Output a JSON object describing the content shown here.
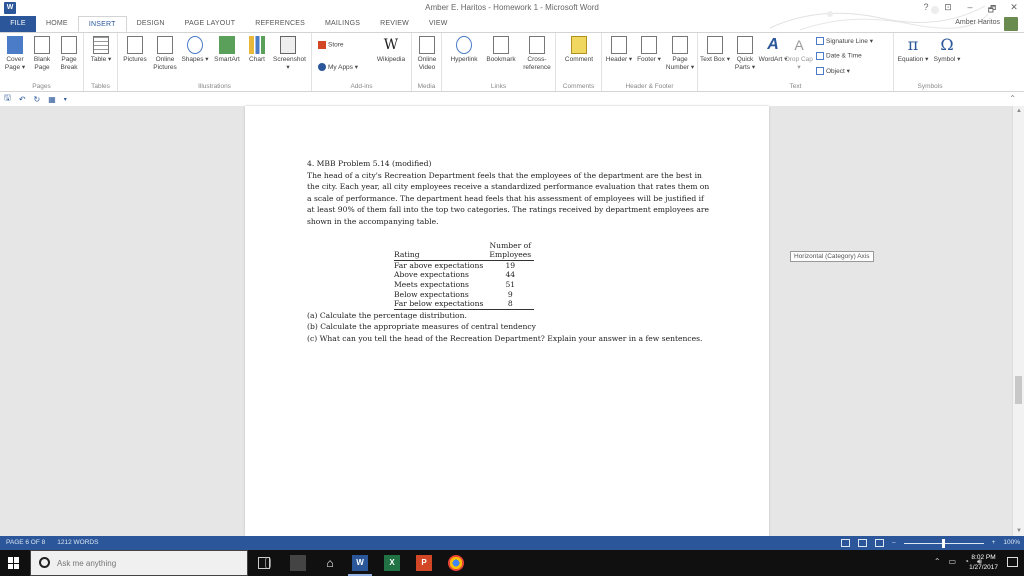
{
  "window": {
    "title": "Amber E. Haritos - Homework 1 - Microsoft Word",
    "controls": [
      "?",
      "⊡",
      "–",
      "🗗",
      "✕"
    ]
  },
  "tabs": [
    {
      "label": "FILE"
    },
    {
      "label": "HOME"
    },
    {
      "label": "INSERT"
    },
    {
      "label": "DESIGN"
    },
    {
      "label": "PAGE LAYOUT"
    },
    {
      "label": "REFERENCES"
    },
    {
      "label": "MAILINGS"
    },
    {
      "label": "REVIEW"
    },
    {
      "label": "VIEW"
    }
  ],
  "active_tab": "INSERT",
  "user_name": "Amber Haritos",
  "ribbon": {
    "groups": [
      {
        "label": "Pages"
      },
      {
        "label": "Tables"
      },
      {
        "label": "Illustrations"
      },
      {
        "label": "Add-ins"
      },
      {
        "label": "Media"
      },
      {
        "label": "Links"
      },
      {
        "label": "Comments"
      },
      {
        "label": "Header & Footer"
      },
      {
        "label": "Text"
      },
      {
        "label": "Symbols"
      }
    ],
    "buttons": {
      "cover_page": "Cover Page ▾",
      "blank_page": "Blank Page",
      "page_break": "Page Break",
      "table": "Table ▾",
      "pictures": "Pictures",
      "online_pictures": "Online Pictures",
      "shapes": "Shapes ▾",
      "smartart": "SmartArt",
      "chart": "Chart",
      "screenshot": "Screenshot ▾",
      "store": "Store",
      "my_apps": "My Apps ▾",
      "wikipedia": "Wikipedia",
      "online_video": "Online Video",
      "hyperlink": "Hyperlink",
      "bookmark": "Bookmark",
      "cross_reference": "Cross-reference",
      "comment": "Comment",
      "header": "Header ▾",
      "footer": "Footer ▾",
      "page_number": "Page Number ▾",
      "text_box": "Text Box ▾",
      "quick_parts": "Quick Parts ▾",
      "wordart": "WordArt ▾",
      "drop_cap": "Drop Cap ▾",
      "signature_line": "Signature Line ▾",
      "date_time": "Date & Time",
      "object": "Object ▾",
      "equation": "Equation ▾",
      "symbol": "Symbol ▾"
    }
  },
  "document": {
    "heading": "4. MBB Problem 5.14 (modified)",
    "paragraph": "The head of a city's Recreation Department feels that the employees of the department are the best in the city. Each year, all city employees receive a standardized performance evaluation that rates them on a scale of performance. The department head feels that his assessment of employees will be justified if at least 90% of them fall into the top two categories. The ratings received by department employees are shown in the accompanying table.",
    "table": {
      "col1": "Rating",
      "col2_line1": "Number of",
      "col2_line2": "Employees",
      "rows": [
        {
          "rating": "Far above expectations",
          "count": "19"
        },
        {
          "rating": "Above expectations",
          "count": "44"
        },
        {
          "rating": "Meets expectations",
          "count": "51"
        },
        {
          "rating": "Below expectations",
          "count": "9"
        },
        {
          "rating": "Far below expectations",
          "count": "8"
        }
      ]
    },
    "question_a": "(a) Calculate the percentage distribution.",
    "question_b": "(b) Calculate the appropriate measures of central tendency",
    "question_c": "(c) What can you tell the head of the Recreation Department? Explain your answer in a few sentences."
  },
  "tooltip": "Horizontal (Category) Axis",
  "status": {
    "page": "PAGE 6 OF 8",
    "words": "1212 WORDS",
    "zoom": "100%"
  },
  "taskbar": {
    "search_placeholder": "Ask me anything",
    "apps": [
      "W",
      "X",
      "P"
    ],
    "time": "8:02 PM",
    "date": "1/27/2017"
  }
}
